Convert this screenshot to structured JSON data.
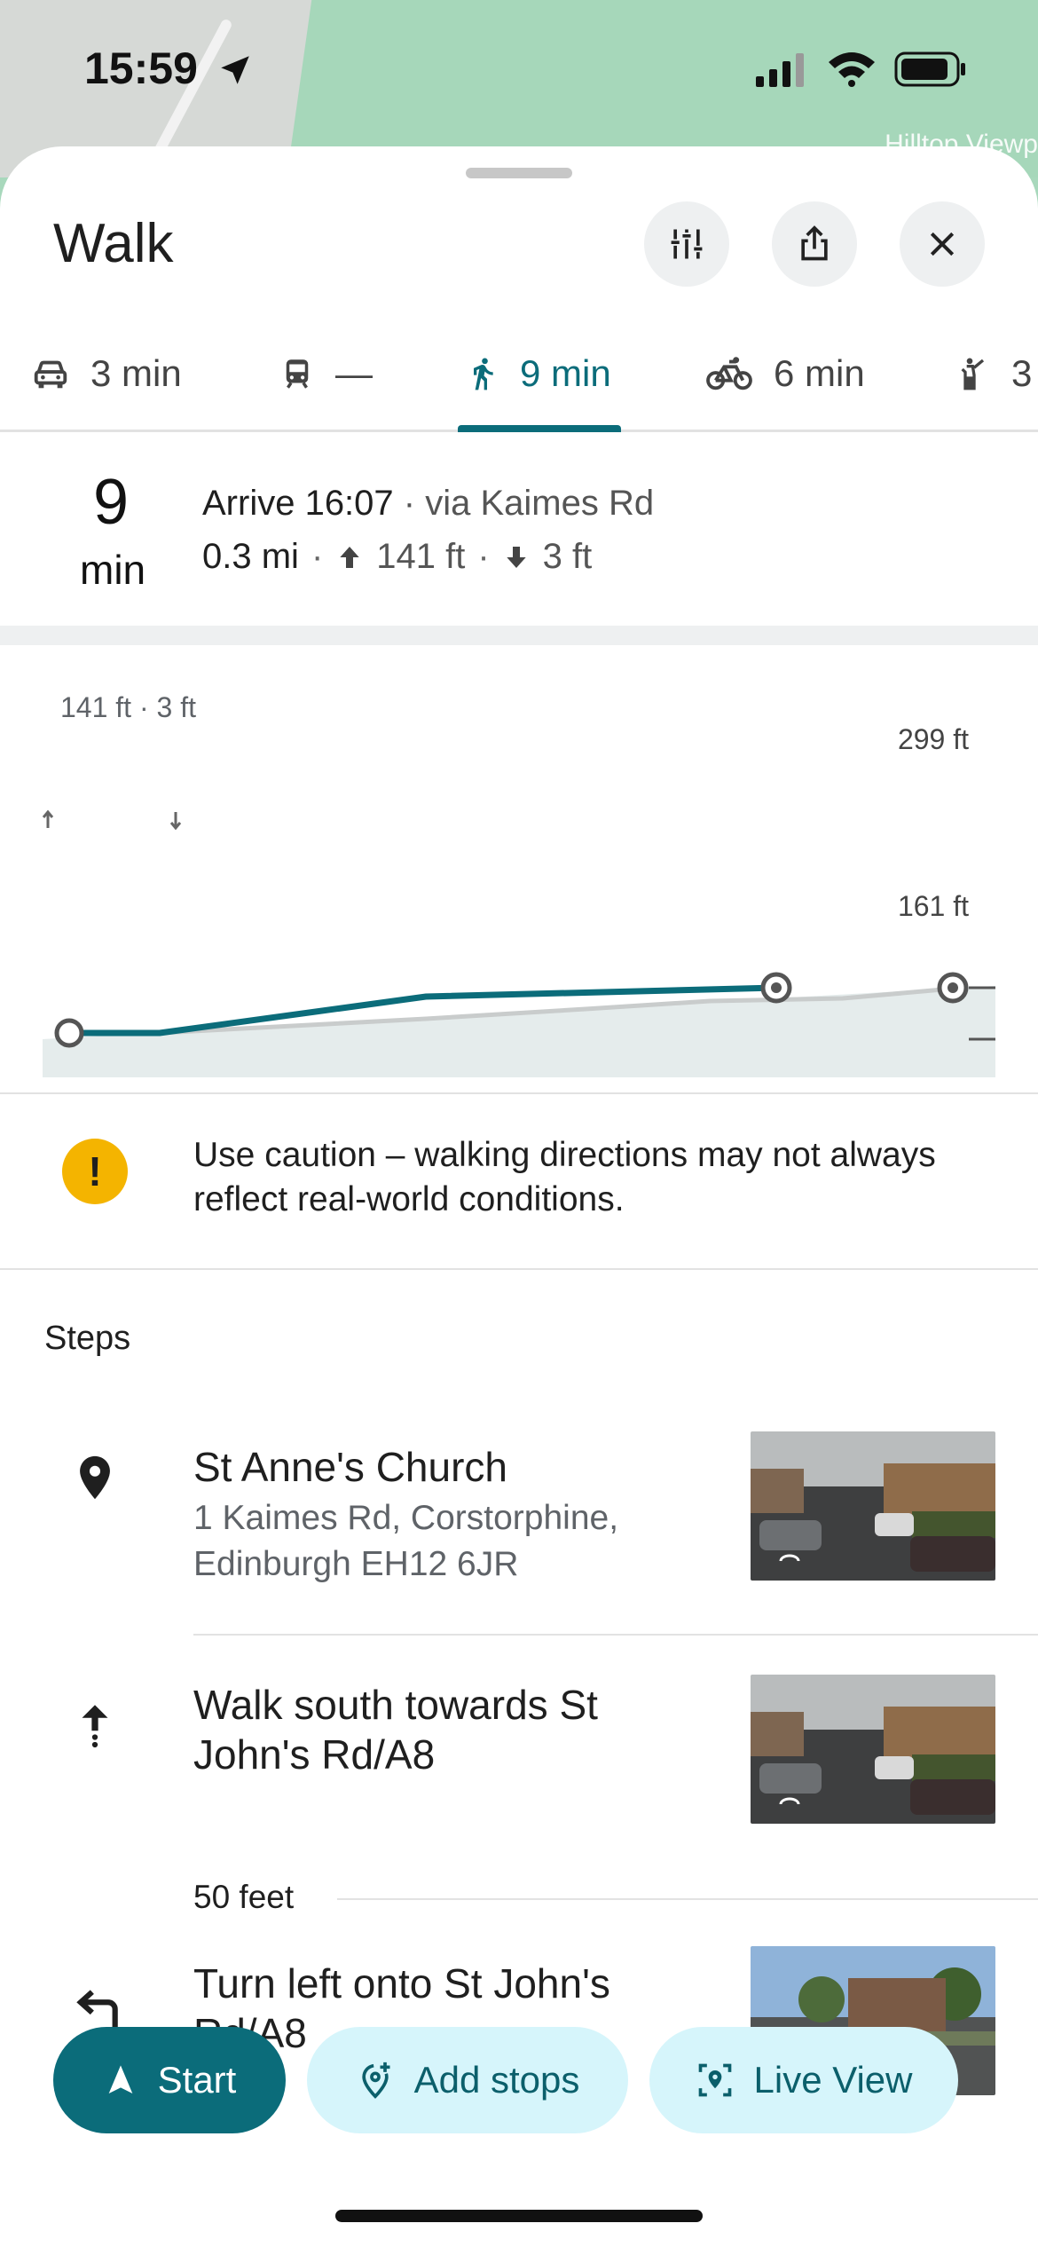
{
  "status_bar": {
    "time": "15:59"
  },
  "map": {
    "label": "Hilltop Viewp"
  },
  "header": {
    "title": "Walk"
  },
  "modes": [
    {
      "icon": "car-icon",
      "label": "3 min"
    },
    {
      "icon": "train-icon",
      "label": "—"
    },
    {
      "icon": "walk-icon",
      "label": "9 min",
      "active": true
    },
    {
      "icon": "bike-icon",
      "label": "6 min"
    },
    {
      "icon": "ride-icon",
      "label": "3"
    }
  ],
  "summary": {
    "minutes": "9",
    "minutes_unit": "min",
    "arrive": "Arrive 16:07",
    "via": " · via Kaimes Rd",
    "distance": "0.3 mi",
    "ascent": "141 ft",
    "descent": "3 ft"
  },
  "elevation": {
    "summary": "141 ft · 3 ft",
    "max_label": "299 ft",
    "min_label": "161 ft"
  },
  "caution": {
    "text": "Use caution – walking directions may not always reflect real-world conditions."
  },
  "steps_heading": "Steps",
  "steps": [
    {
      "icon": "pin-icon",
      "title": "St Anne's Church",
      "subtitle": "1 Kaimes Rd, Corstorphine, Edinburgh EH12 6JR"
    },
    {
      "icon": "arrow-up-icon",
      "title": "Walk south towards St John's Rd/A8"
    },
    {
      "icon": "turn-left-icon",
      "title": "Turn left onto St John's Rd/A8"
    }
  ],
  "step_distance": "50 feet",
  "actions": {
    "start": "Start",
    "add_stops": "Add stops",
    "live_view": "Live View"
  },
  "colors": {
    "accent": "#0b6c7a",
    "secondary_bg": "#d6f5fb",
    "warning": "#f4b400"
  }
}
